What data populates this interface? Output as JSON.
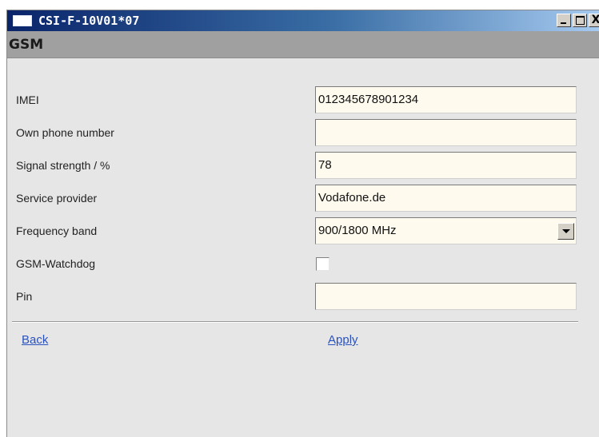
{
  "window": {
    "title": "CSI-F-10V01*07",
    "controls": {
      "minimize": "minimize-icon",
      "maximize": "maximize-icon",
      "close_label": "X"
    }
  },
  "section": {
    "title": "GSM"
  },
  "rows": [
    {
      "label": "IMEI",
      "value": "012345678901234",
      "type": "text"
    },
    {
      "label": "Own phone number",
      "value": "",
      "type": "text"
    },
    {
      "label": "Signal strength / %",
      "value": "78",
      "type": "text"
    },
    {
      "label": "Service provider",
      "value": "Vodafone.de",
      "type": "text"
    },
    {
      "label": "Frequency band",
      "value": "900/1800 MHz",
      "type": "select"
    },
    {
      "label": "GSM-Watchdog",
      "checked": false,
      "type": "checkbox"
    },
    {
      "label": "Pin",
      "value": "",
      "type": "text"
    }
  ],
  "actions": {
    "back": "Back",
    "apply": "Apply"
  }
}
